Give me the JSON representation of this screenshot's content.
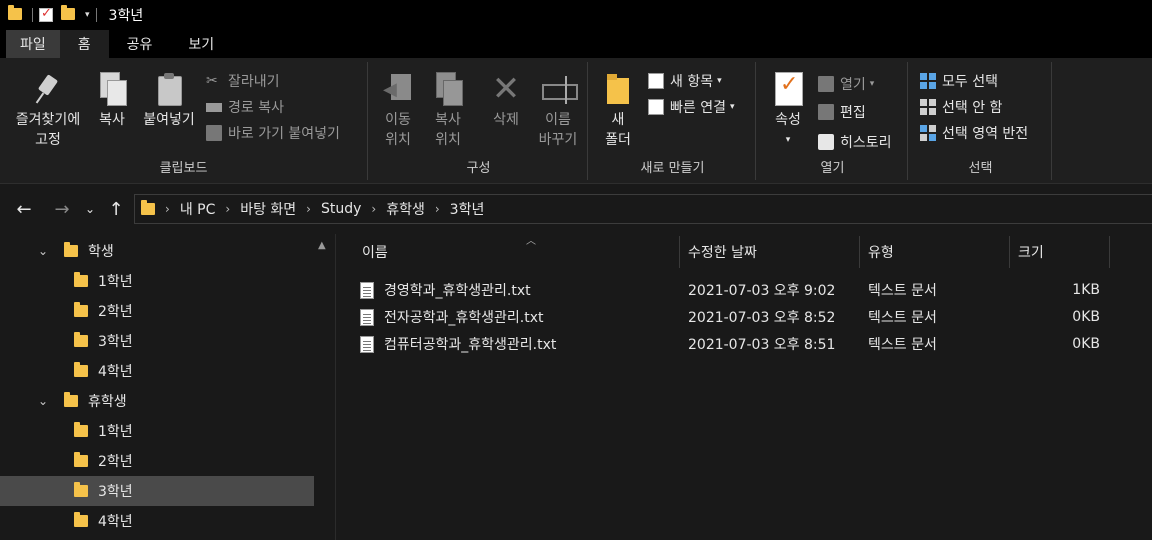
{
  "window": {
    "title": "3학년"
  },
  "ribbon_tabs": [
    "파일",
    "홈",
    "공유",
    "보기"
  ],
  "ribbon": {
    "clipboard": {
      "label": "클립보드",
      "pin_label_1": "즐겨찾기에",
      "pin_label_2": "고정",
      "copy": "복사",
      "paste": "붙여넣기",
      "cut": "잘라내기",
      "copy_path": "경로 복사",
      "paste_shortcut": "바로 가기 붙여넣기"
    },
    "organize": {
      "label": "구성",
      "move_1": "이동",
      "move_2": "위치",
      "copyto_1": "복사",
      "copyto_2": "위치",
      "delete": "삭제",
      "rename_1": "이름",
      "rename_2": "바꾸기"
    },
    "new": {
      "label": "새로 만들기",
      "new_folder_1": "새",
      "new_folder_2": "폴더",
      "new_item": "새 항목",
      "easy_access": "빠른 연결"
    },
    "open": {
      "label": "열기",
      "properties": "속성",
      "open": "열기",
      "edit": "편집",
      "history": "히스토리"
    },
    "select": {
      "label": "선택",
      "select_all": "모두 선택",
      "select_none": "선택 안 함",
      "invert": "선택 영역 반전"
    }
  },
  "address": {
    "crumbs": [
      "내 PC",
      "바탕 화면",
      "Study",
      "휴학생",
      "3학년"
    ]
  },
  "tree": [
    {
      "label": "학생",
      "level": 0,
      "expanded": true
    },
    {
      "label": "1학년",
      "level": 1
    },
    {
      "label": "2학년",
      "level": 1
    },
    {
      "label": "3학년",
      "level": 1
    },
    {
      "label": "4학년",
      "level": 1
    },
    {
      "label": "휴학생",
      "level": 0,
      "expanded": true
    },
    {
      "label": "1학년",
      "level": 1
    },
    {
      "label": "2학년",
      "level": 1
    },
    {
      "label": "3학년",
      "level": 1,
      "selected": true
    },
    {
      "label": "4학년",
      "level": 1
    }
  ],
  "columns": {
    "name": "이름",
    "date": "수정한 날짜",
    "type": "유형",
    "size": "크기"
  },
  "files": [
    {
      "name": "경영학과_휴학생관리.txt",
      "date": "2021-07-03 오후 9:02",
      "type": "텍스트 문서",
      "size": "1KB"
    },
    {
      "name": "전자공학과_휴학생관리.txt",
      "date": "2021-07-03 오후 8:52",
      "type": "텍스트 문서",
      "size": "0KB"
    },
    {
      "name": "컴퓨터공학과_휴학생관리.txt",
      "date": "2021-07-03 오후 8:51",
      "type": "텍스트 문서",
      "size": "0KB"
    }
  ]
}
